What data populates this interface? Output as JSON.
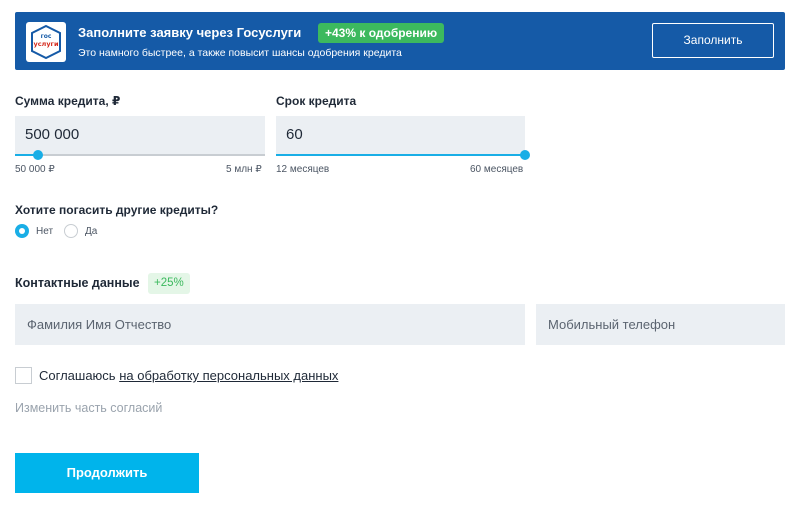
{
  "banner": {
    "logo_text_top": "гос",
    "logo_text_bottom": "услуги",
    "title": "Заполните заявку через Госуслуги",
    "badge": "+43% к одобрению",
    "subtitle": "Это намного быстрее, а также повысит шансы одобрения кредита",
    "button_label": "Заполнить"
  },
  "amount": {
    "label": "Сумма кредита, ₽",
    "value": "500 000",
    "min_label": "50 000 ₽",
    "max_label": "5 млн ₽",
    "slider_fraction": 0.09
  },
  "term": {
    "label": "Срок кредита",
    "value": "60",
    "min_label": "12 месяцев",
    "max_label": "60 месяцев",
    "slider_fraction": 1.0
  },
  "refinance": {
    "question": "Хотите погасить другие кредиты?",
    "options": [
      {
        "label": "Нет",
        "checked": true
      },
      {
        "label": "Да",
        "checked": false
      }
    ]
  },
  "contacts": {
    "title": "Контактные данные",
    "badge": "+25%",
    "name_placeholder": "Фамилия Имя Отчество",
    "phone_placeholder": "Мобильный телефон"
  },
  "consent": {
    "prefix": "Соглашаюсь ",
    "link": "на обработку персональных данных",
    "change_label": "Изменить часть согласий"
  },
  "continue_label": "Продолжить",
  "colors": {
    "banner_bg": "#155aa7",
    "accent": "#19aee6",
    "success": "#3cb95e",
    "input_bg": "#ebeff3"
  }
}
